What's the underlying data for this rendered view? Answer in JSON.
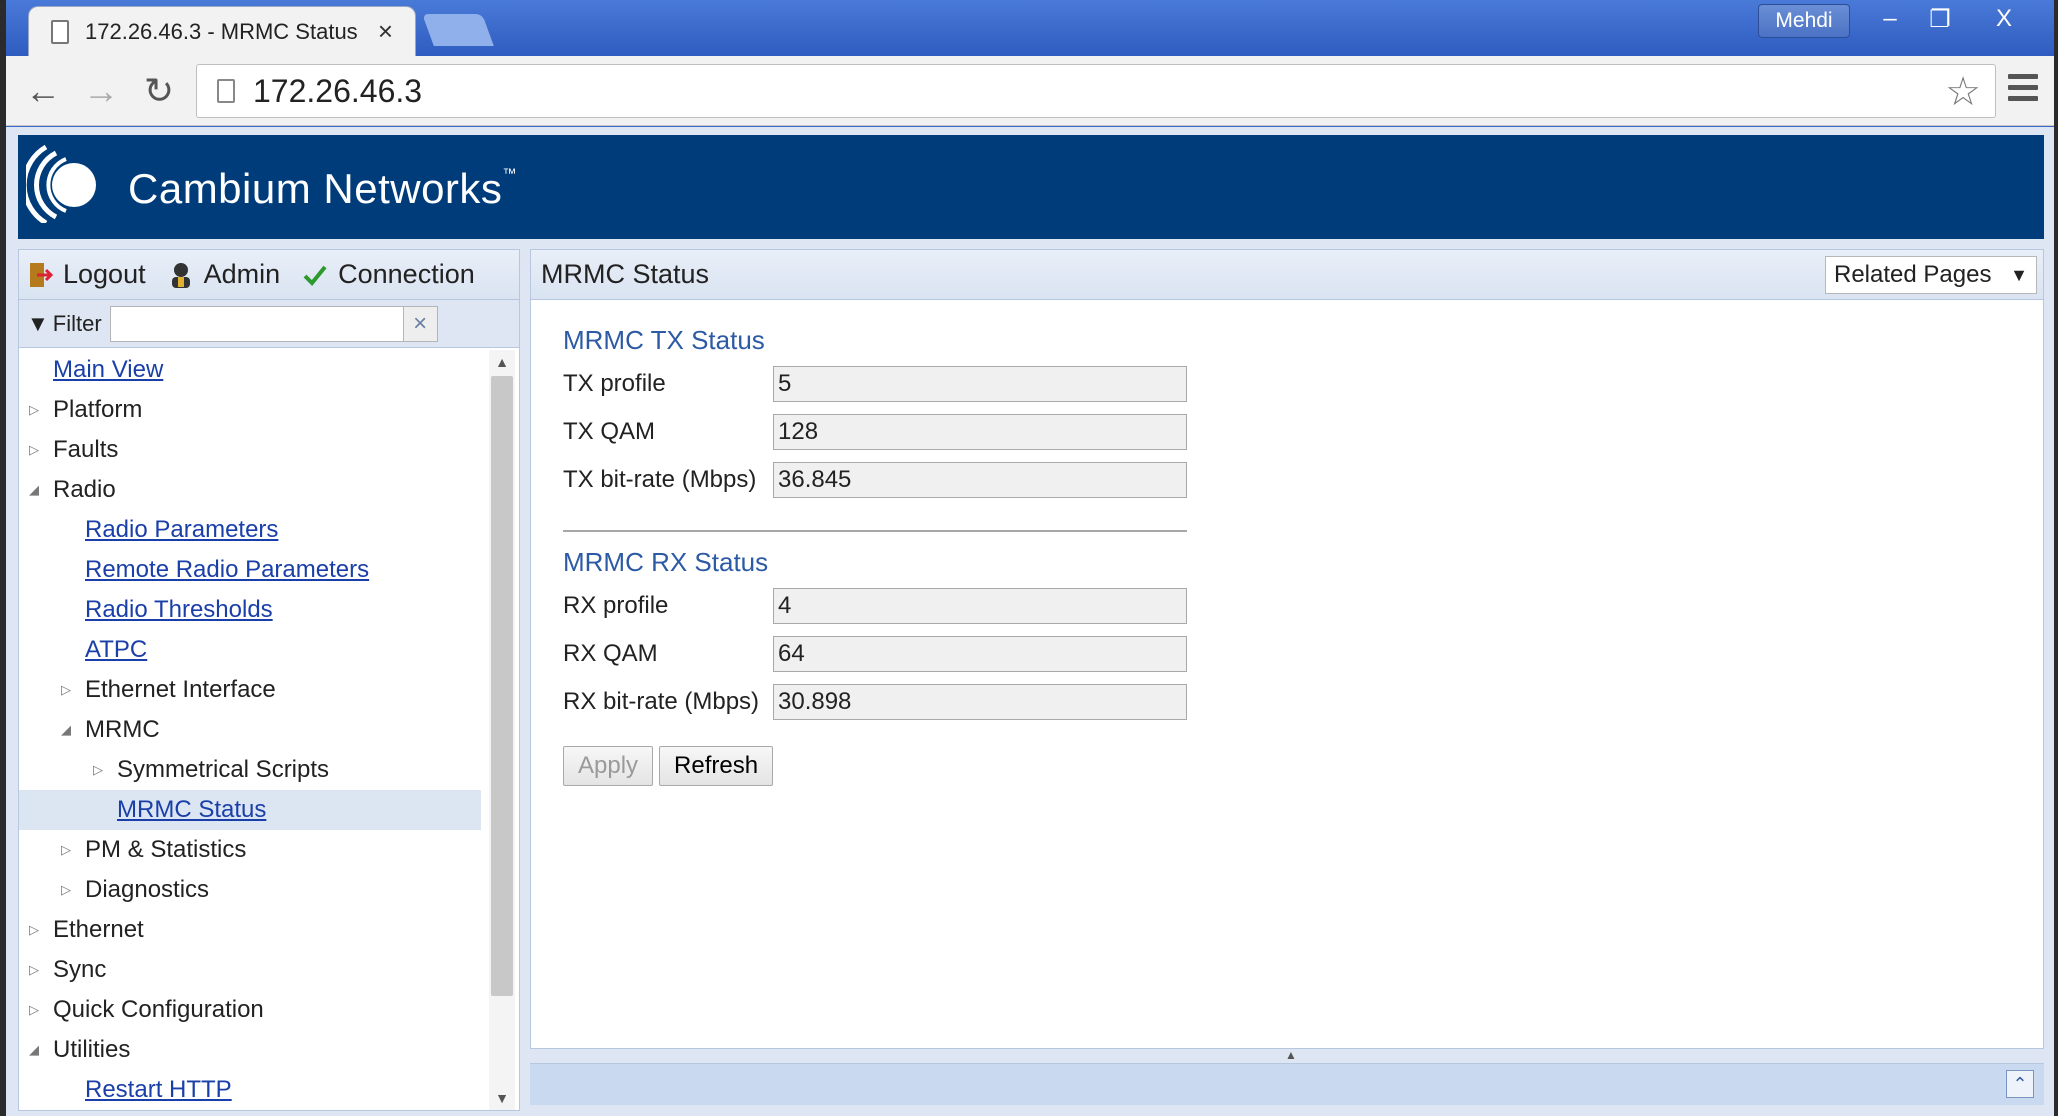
{
  "browser": {
    "tab_title": "172.26.46.3 - MRMC Status",
    "tab_close": "×",
    "user": "Mehdi",
    "url": "172.26.46.3",
    "window_buttons": [
      "–",
      "❐",
      "X"
    ]
  },
  "header": {
    "brand": "Cambium Networks",
    "trademark": "™"
  },
  "left_panel": {
    "logout": "Logout",
    "admin": "Admin",
    "connection": "Connection",
    "filter_label": "Filter",
    "filter_value": "",
    "filter_clear": "×",
    "tree": [
      {
        "label": "Main View",
        "level": 0,
        "expander": "",
        "link": true
      },
      {
        "label": "Platform",
        "level": 0,
        "expander": "collapsed",
        "link": false
      },
      {
        "label": "Faults",
        "level": 0,
        "expander": "collapsed",
        "link": false
      },
      {
        "label": "Radio",
        "level": 0,
        "expander": "expanded",
        "link": false
      },
      {
        "label": "Radio Parameters",
        "level": 1,
        "expander": "",
        "link": true
      },
      {
        "label": "Remote Radio Parameters",
        "level": 1,
        "expander": "",
        "link": true
      },
      {
        "label": "Radio Thresholds",
        "level": 1,
        "expander": "",
        "link": true
      },
      {
        "label": "ATPC",
        "level": 1,
        "expander": "",
        "link": true
      },
      {
        "label": "Ethernet Interface",
        "level": 1,
        "expander": "collapsed",
        "link": false
      },
      {
        "label": "MRMC",
        "level": 1,
        "expander": "expanded",
        "link": false
      },
      {
        "label": "Symmetrical Scripts",
        "level": 2,
        "expander": "collapsed",
        "link": false
      },
      {
        "label": "MRMC Status",
        "level": 2,
        "expander": "",
        "link": true,
        "selected": true
      },
      {
        "label": "PM & Statistics",
        "level": 1,
        "expander": "collapsed",
        "link": false
      },
      {
        "label": "Diagnostics",
        "level": 1,
        "expander": "collapsed",
        "link": false
      },
      {
        "label": "Ethernet",
        "level": 0,
        "expander": "collapsed",
        "link": false
      },
      {
        "label": "Sync",
        "level": 0,
        "expander": "collapsed",
        "link": false
      },
      {
        "label": "Quick Configuration",
        "level": 0,
        "expander": "collapsed",
        "link": false
      },
      {
        "label": "Utilities",
        "level": 0,
        "expander": "expanded",
        "link": false
      },
      {
        "label": "Restart HTTP",
        "level": 1,
        "expander": "",
        "link": true
      }
    ]
  },
  "main": {
    "title": "MRMC Status",
    "related_pages": "Related Pages",
    "tx": {
      "title": "MRMC TX Status",
      "fields": [
        {
          "label": "TX profile",
          "value": "5"
        },
        {
          "label": "TX QAM",
          "value": "128"
        },
        {
          "label": "TX bit-rate (Mbps)",
          "value": "36.845"
        }
      ]
    },
    "rx": {
      "title": "MRMC RX Status",
      "fields": [
        {
          "label": "RX profile",
          "value": "4"
        },
        {
          "label": "RX QAM",
          "value": "64"
        },
        {
          "label": "RX bit-rate (Mbps)",
          "value": "30.898"
        }
      ]
    },
    "apply": "Apply",
    "refresh": "Refresh"
  },
  "colors": {
    "banner": "#003b7a",
    "link": "#1a3fa8",
    "section_title": "#2d5aa5"
  }
}
